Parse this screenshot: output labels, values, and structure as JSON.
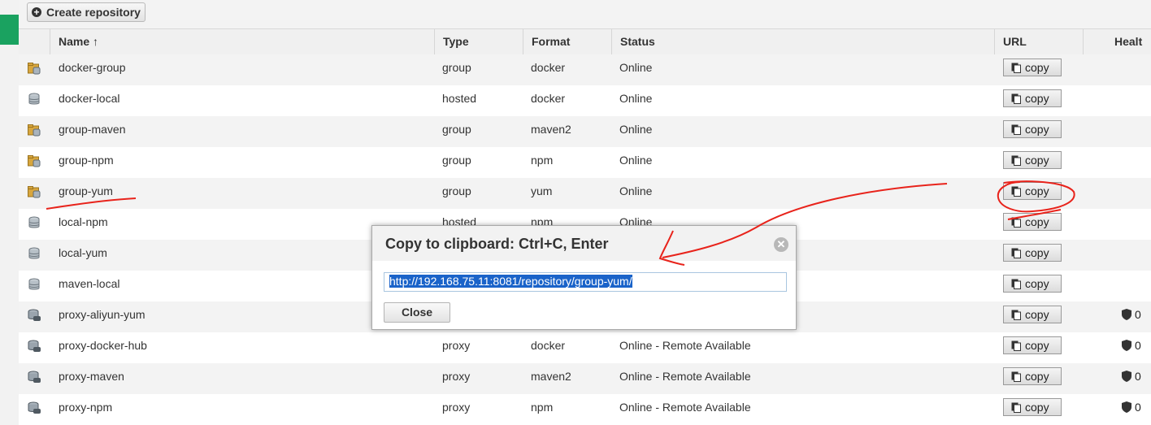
{
  "toolbar": {
    "create_label": "Create repository"
  },
  "columns": {
    "name": "Name ↑",
    "type": "Type",
    "format": "Format",
    "status": "Status",
    "url": "URL",
    "health": "Healt"
  },
  "copy_label": "copy",
  "rows": [
    {
      "name": "docker-group",
      "type": "group",
      "format": "docker",
      "status": "Online",
      "icon": "group"
    },
    {
      "name": "docker-local",
      "type": "hosted",
      "format": "docker",
      "status": "Online",
      "icon": "hosted"
    },
    {
      "name": "group-maven",
      "type": "group",
      "format": "maven2",
      "status": "Online",
      "icon": "group"
    },
    {
      "name": "group-npm",
      "type": "group",
      "format": "npm",
      "status": "Online",
      "icon": "group"
    },
    {
      "name": "group-yum",
      "type": "group",
      "format": "yum",
      "status": "Online",
      "icon": "group"
    },
    {
      "name": "local-npm",
      "type": "hosted",
      "format": "npm",
      "status": "Online",
      "icon": "hosted"
    },
    {
      "name": "local-yum",
      "type": "",
      "format": "",
      "status": "",
      "icon": "hosted"
    },
    {
      "name": "maven-local",
      "type": "",
      "format": "",
      "status": "",
      "icon": "hosted"
    },
    {
      "name": "proxy-aliyun-yum",
      "type": "",
      "format": "",
      "status": "",
      "icon": "proxy",
      "health": "0"
    },
    {
      "name": "proxy-docker-hub",
      "type": "proxy",
      "format": "docker",
      "status": "Online - Remote Available",
      "icon": "proxy",
      "health": "0"
    },
    {
      "name": "proxy-maven",
      "type": "proxy",
      "format": "maven2",
      "status": "Online - Remote Available",
      "icon": "proxy",
      "health": "0"
    },
    {
      "name": "proxy-npm",
      "type": "proxy",
      "format": "npm",
      "status": "Online - Remote Available",
      "icon": "proxy",
      "health": "0"
    }
  ],
  "modal": {
    "title": "Copy to clipboard: Ctrl+C, Enter",
    "url": "http://192.168.75.11:8081/repository/group-yum/",
    "close_label": "Close"
  },
  "colors": {
    "annotation": "#e8231b",
    "selection": "#1a63c9",
    "accent_green": "#1aa260"
  }
}
